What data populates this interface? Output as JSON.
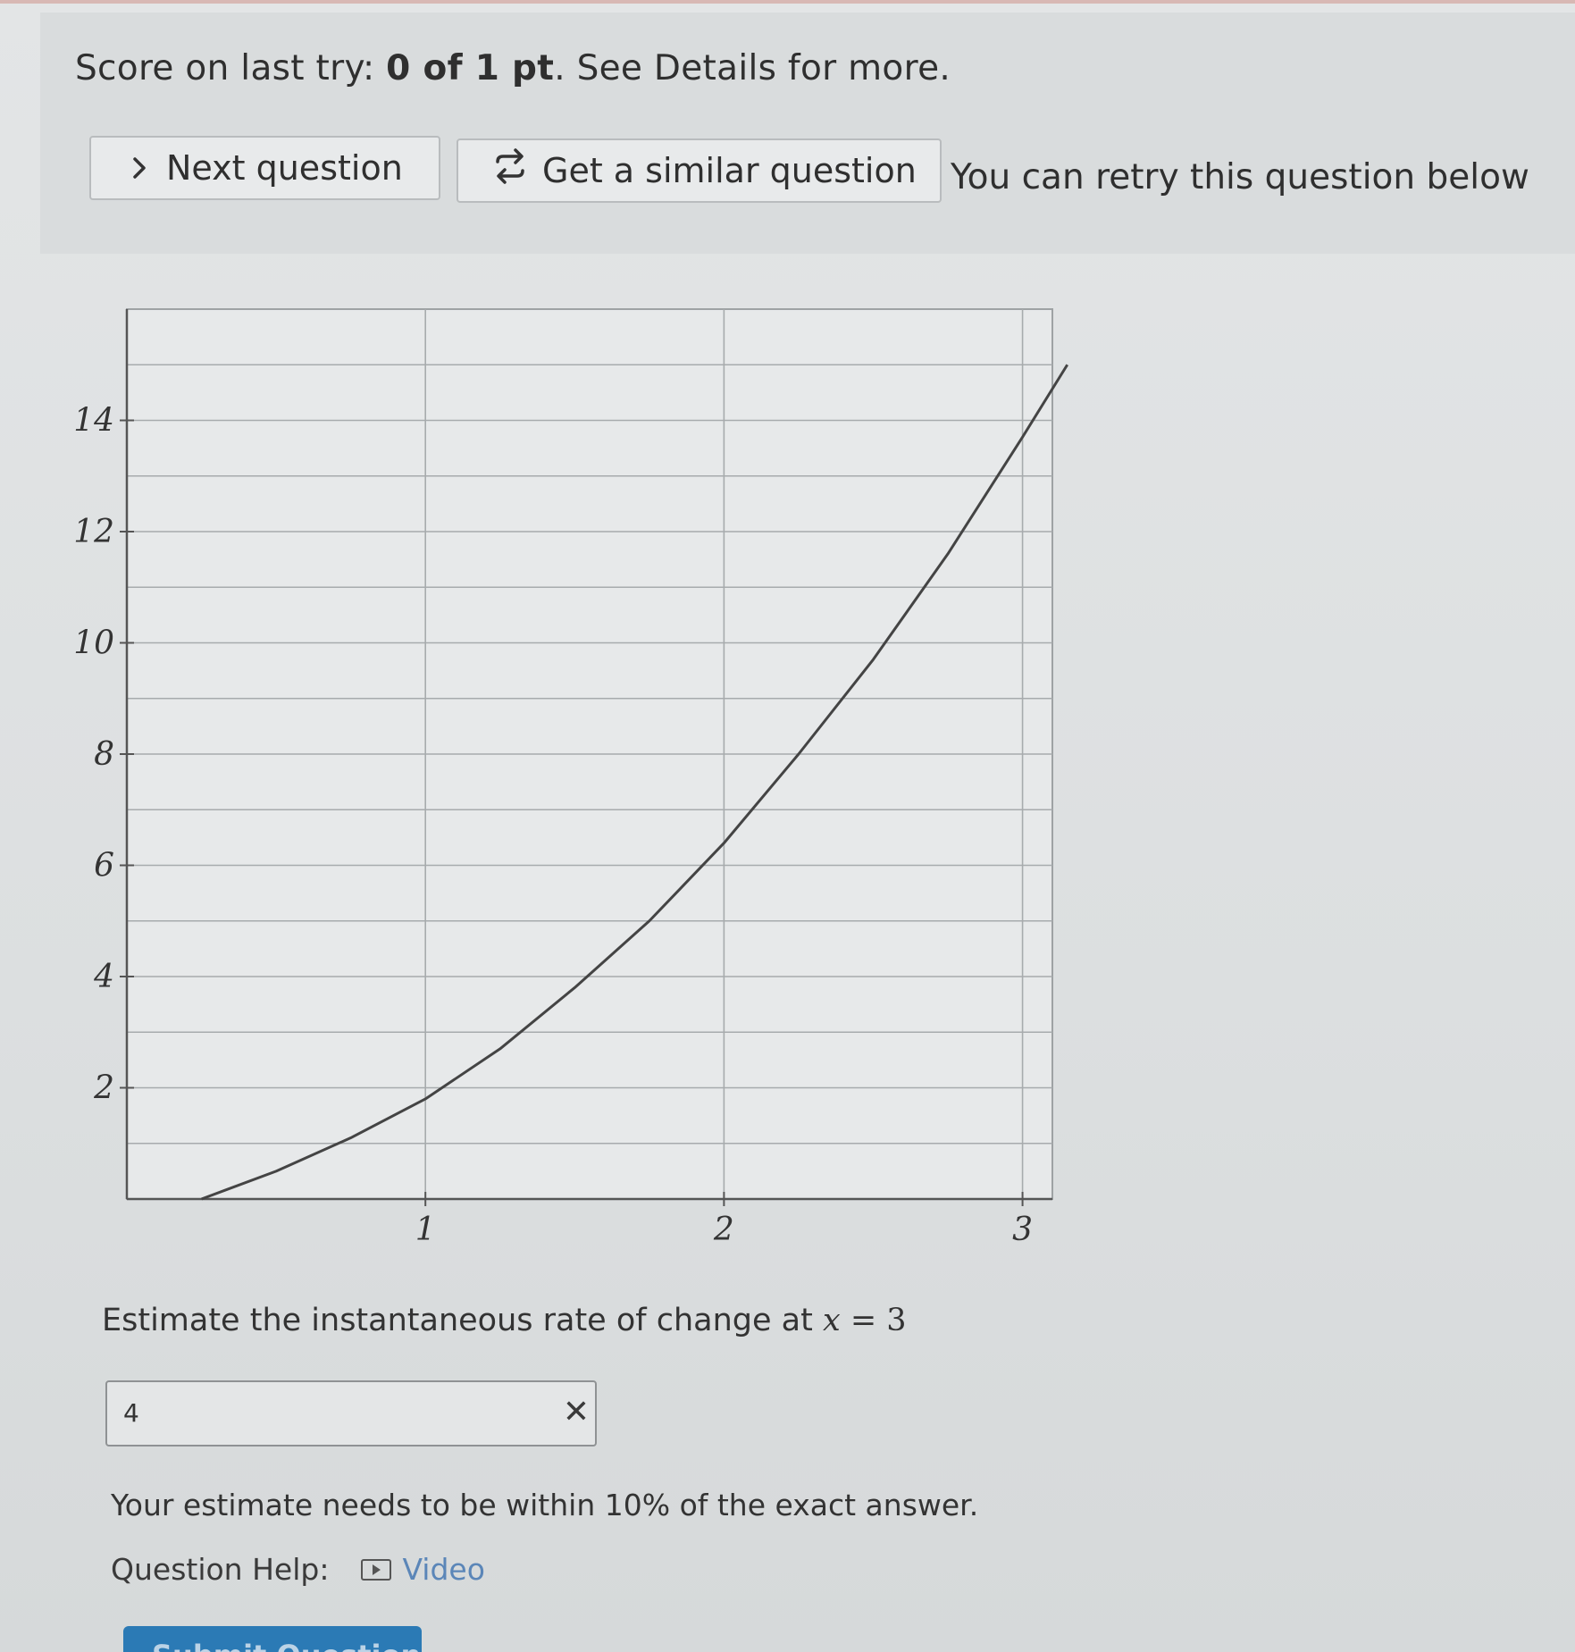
{
  "score": {
    "prefix": "Score on last try: ",
    "value": "0 of 1 pt",
    "suffix": ". See Details for more."
  },
  "actions": {
    "next_label": "Next question",
    "similar_label": "Get a similar question",
    "retry_text": "You can retry this question below"
  },
  "chart_data": {
    "type": "line",
    "title": "",
    "xlabel": "",
    "ylabel": "",
    "xlim": [
      0,
      3.1
    ],
    "ylim": [
      0,
      16
    ],
    "x_ticks": [
      1,
      2,
      3
    ],
    "y_ticks": [
      2,
      4,
      6,
      8,
      10,
      12,
      14
    ],
    "grid": true,
    "x_grid_step": 1,
    "y_grid_step": 1,
    "series": [
      {
        "x": [
          0.25,
          0.5,
          0.75,
          1.0,
          1.25,
          1.5,
          1.75,
          2.0,
          2.25,
          2.5,
          2.75,
          3.0,
          3.15
        ],
        "y": [
          0.0,
          0.5,
          1.1,
          1.8,
          2.7,
          3.8,
          5.0,
          6.4,
          8.0,
          9.7,
          11.6,
          13.7,
          15.0
        ]
      }
    ]
  },
  "question": {
    "prompt": "Estimate the instantaneous rate of change at ",
    "math_var": "x",
    "math_eq": " = 3",
    "answer_value": "4",
    "wrong_mark": "✕",
    "tolerance": "Your estimate needs to be within 10% of the exact answer."
  },
  "help": {
    "label": "Question Help:",
    "video_label": "Video"
  },
  "submit_label": "Submit Question"
}
